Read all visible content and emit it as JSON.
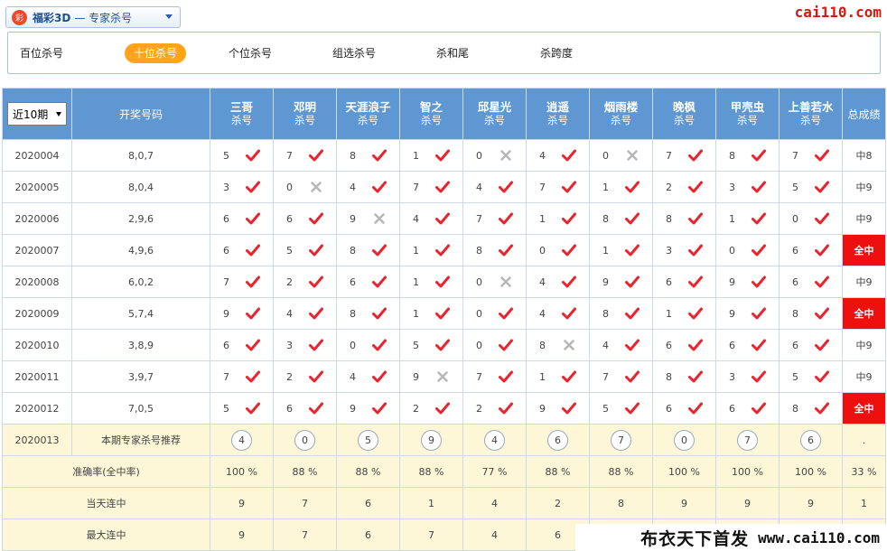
{
  "header": {
    "dropdown_prefix": "福彩3D",
    "dropdown_sep": "—",
    "dropdown_label": "专家杀号",
    "brand": "cai110.com",
    "accent_color": "#ffa41c",
    "header_color": "#5f97d2"
  },
  "tabs": [
    {
      "label": "百位杀号",
      "active": false
    },
    {
      "label": "十位杀号",
      "active": true
    },
    {
      "label": "个位杀号",
      "active": false
    },
    {
      "label": "组选杀号",
      "active": false
    },
    {
      "label": "杀和尾",
      "active": false
    },
    {
      "label": "杀跨度",
      "active": false
    }
  ],
  "table": {
    "period_select": "近10期",
    "draw_col": "开奖号码",
    "total_col": "总成绩",
    "kill_label": "杀号",
    "experts": [
      "三哥",
      "邓明",
      "天涯浪子",
      "智之",
      "邱星光",
      "逍遥",
      "烟雨楼",
      "晚枫",
      "甲壳虫",
      "上善若水"
    ],
    "rows": [
      {
        "issue": "2020004",
        "draw": "8,0,7",
        "picks": [
          [
            "5",
            1
          ],
          [
            "7",
            1
          ],
          [
            "8",
            1
          ],
          [
            "1",
            1
          ],
          [
            "0",
            0
          ],
          [
            "4",
            1
          ],
          [
            "0",
            0
          ],
          [
            "7",
            1
          ],
          [
            "8",
            1
          ],
          [
            "7",
            1
          ]
        ],
        "total": "中8",
        "full": false
      },
      {
        "issue": "2020005",
        "draw": "8,0,4",
        "picks": [
          [
            "3",
            1
          ],
          [
            "0",
            0
          ],
          [
            "4",
            1
          ],
          [
            "7",
            1
          ],
          [
            "4",
            1
          ],
          [
            "7",
            1
          ],
          [
            "1",
            1
          ],
          [
            "2",
            1
          ],
          [
            "3",
            1
          ],
          [
            "5",
            1
          ]
        ],
        "total": "中9",
        "full": false
      },
      {
        "issue": "2020006",
        "draw": "2,9,6",
        "picks": [
          [
            "6",
            1
          ],
          [
            "6",
            1
          ],
          [
            "9",
            0
          ],
          [
            "4",
            1
          ],
          [
            "7",
            1
          ],
          [
            "1",
            1
          ],
          [
            "8",
            1
          ],
          [
            "8",
            1
          ],
          [
            "1",
            1
          ],
          [
            "0",
            1
          ]
        ],
        "total": "中9",
        "full": false
      },
      {
        "issue": "2020007",
        "draw": "4,9,6",
        "picks": [
          [
            "6",
            1
          ],
          [
            "5",
            1
          ],
          [
            "8",
            1
          ],
          [
            "1",
            1
          ],
          [
            "8",
            1
          ],
          [
            "0",
            1
          ],
          [
            "1",
            1
          ],
          [
            "3",
            1
          ],
          [
            "0",
            1
          ],
          [
            "6",
            1
          ]
        ],
        "total": "全中",
        "full": true
      },
      {
        "issue": "2020008",
        "draw": "6,0,2",
        "picks": [
          [
            "7",
            1
          ],
          [
            "2",
            1
          ],
          [
            "6",
            1
          ],
          [
            "1",
            1
          ],
          [
            "0",
            0
          ],
          [
            "4",
            1
          ],
          [
            "9",
            1
          ],
          [
            "6",
            1
          ],
          [
            "9",
            1
          ],
          [
            "6",
            1
          ]
        ],
        "total": "中9",
        "full": false
      },
      {
        "issue": "2020009",
        "draw": "5,7,4",
        "picks": [
          [
            "9",
            1
          ],
          [
            "4",
            1
          ],
          [
            "8",
            1
          ],
          [
            "1",
            1
          ],
          [
            "0",
            1
          ],
          [
            "4",
            1
          ],
          [
            "8",
            1
          ],
          [
            "1",
            1
          ],
          [
            "9",
            1
          ],
          [
            "8",
            1
          ]
        ],
        "total": "全中",
        "full": true
      },
      {
        "issue": "2020010",
        "draw": "3,8,9",
        "picks": [
          [
            "6",
            1
          ],
          [
            "3",
            1
          ],
          [
            "0",
            1
          ],
          [
            "5",
            1
          ],
          [
            "0",
            1
          ],
          [
            "8",
            0
          ],
          [
            "4",
            1
          ],
          [
            "6",
            1
          ],
          [
            "6",
            1
          ],
          [
            "6",
            1
          ]
        ],
        "total": "中9",
        "full": false
      },
      {
        "issue": "2020011",
        "draw": "3,9,7",
        "picks": [
          [
            "7",
            1
          ],
          [
            "2",
            1
          ],
          [
            "4",
            1
          ],
          [
            "9",
            0
          ],
          [
            "7",
            1
          ],
          [
            "1",
            1
          ],
          [
            "7",
            1
          ],
          [
            "8",
            1
          ],
          [
            "3",
            1
          ],
          [
            "5",
            1
          ]
        ],
        "total": "中9",
        "full": false
      },
      {
        "issue": "2020012",
        "draw": "7,0,5",
        "picks": [
          [
            "5",
            1
          ],
          [
            "6",
            1
          ],
          [
            "9",
            1
          ],
          [
            "2",
            1
          ],
          [
            "2",
            1
          ],
          [
            "9",
            1
          ],
          [
            "5",
            1
          ],
          [
            "6",
            1
          ],
          [
            "6",
            1
          ],
          [
            "8",
            1
          ]
        ],
        "total": "全中",
        "full": true
      }
    ],
    "recommend": {
      "issue": "2020013",
      "label": "本期专家杀号推荐",
      "balls": [
        "4",
        "0",
        "5",
        "9",
        "4",
        "6",
        "7",
        "0",
        "7",
        "6"
      ],
      "total": "."
    },
    "stats": [
      {
        "label": "准确率(全中率)",
        "values": [
          "100 %",
          "88 %",
          "88 %",
          "88 %",
          "77 %",
          "88 %",
          "88 %",
          "100 %",
          "100 %",
          "100 %"
        ],
        "total": "33 %"
      },
      {
        "label": "当天连中",
        "values": [
          "9",
          "7",
          "6",
          "1",
          "4",
          "2",
          "8",
          "9",
          "9",
          "9"
        ],
        "total": "1"
      },
      {
        "label": "最大连中",
        "values": [
          "9",
          "7",
          "6",
          "7",
          "4",
          "6",
          "",
          "",
          "",
          ""
        ],
        "total": ""
      }
    ]
  },
  "watermark": {
    "text_a": "布衣天下首发",
    "text_b": "www.cai110.com"
  }
}
